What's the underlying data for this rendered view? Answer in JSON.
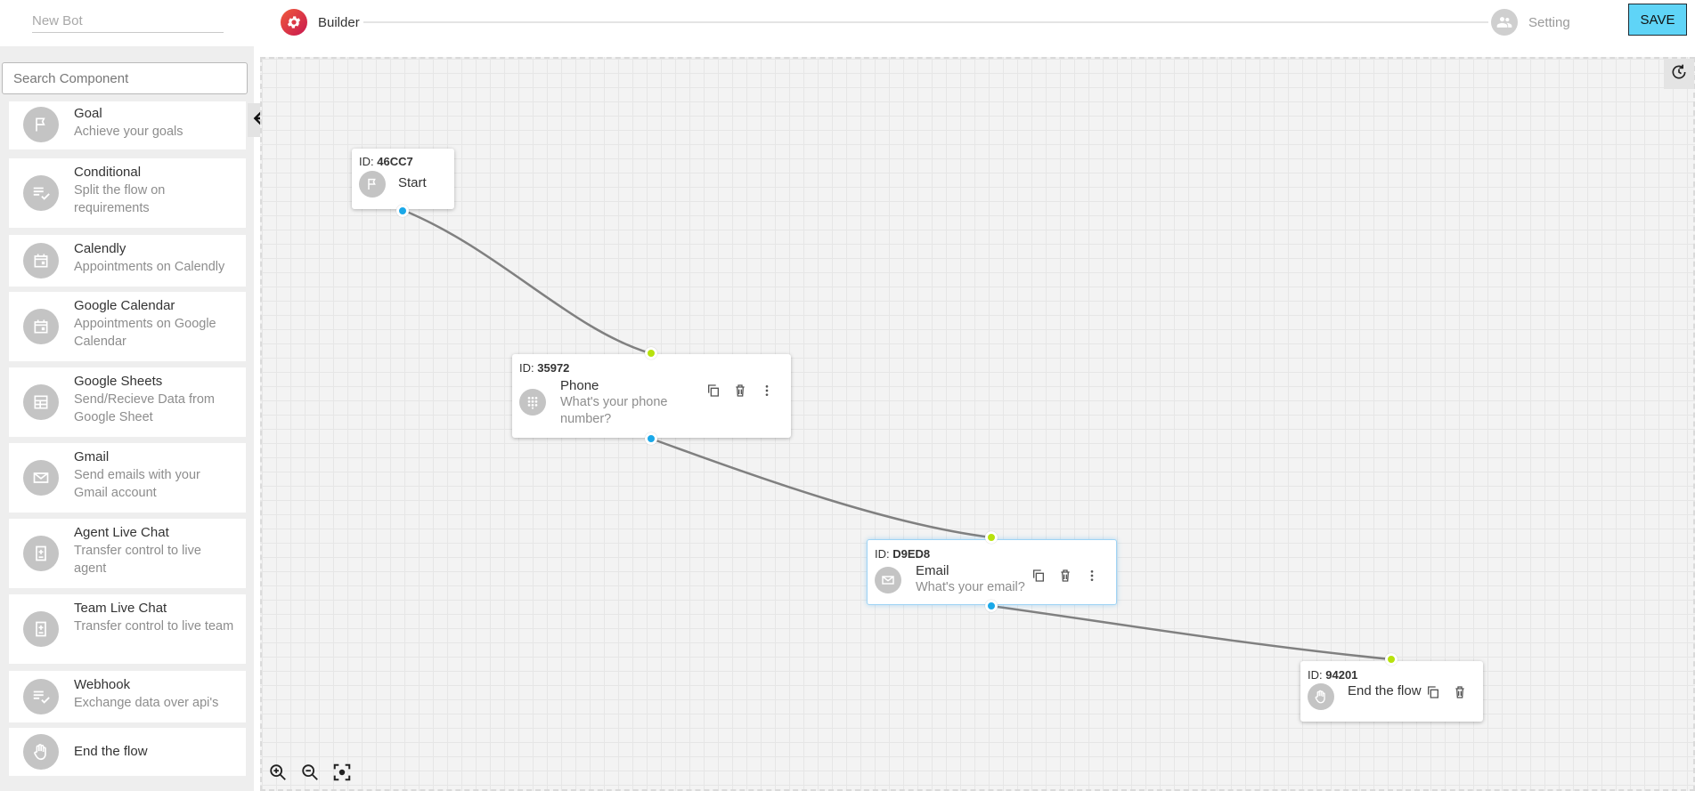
{
  "header": {
    "bot_name_placeholder": "New Bot",
    "steps": [
      {
        "label": "Builder",
        "icon": "gear-icon",
        "active": true
      },
      {
        "label": "Setting",
        "icon": "group-icon",
        "active": false
      }
    ],
    "save_label": "SAVE"
  },
  "sidebar": {
    "search_placeholder": "Search Component",
    "components": [
      {
        "title": "Goal",
        "desc": "Achieve your goals",
        "icon": "flag-icon"
      },
      {
        "title": "Conditional",
        "desc": "Split the flow on requirements",
        "icon": "checklist-icon"
      },
      {
        "title": "Calendly",
        "desc": "Appointments on Calendly",
        "icon": "calendar-icon"
      },
      {
        "title": "Google Calendar",
        "desc": "Appointments on Google Calendar",
        "icon": "calendar-icon"
      },
      {
        "title": "Google Sheets",
        "desc": "Send/Recieve Data from Google Sheet",
        "icon": "sheet-icon"
      },
      {
        "title": "Gmail",
        "desc": "Send emails with your Gmail account",
        "icon": "mail-icon"
      },
      {
        "title": "Agent Live Chat",
        "desc": "Transfer control to live agent",
        "icon": "badge-icon"
      },
      {
        "title": "Team Live Chat",
        "desc": "Transfer control to live team",
        "icon": "badge-icon"
      },
      {
        "title": "Webhook",
        "desc": "Exchange data over api's",
        "icon": "checklist-icon"
      },
      {
        "title": "End the flow",
        "desc": "",
        "icon": "hand-icon"
      }
    ]
  },
  "canvas": {
    "nodes": [
      {
        "id_label": "ID:",
        "id": "46CC7",
        "title": "Start",
        "desc": "",
        "icon": "flag-icon"
      },
      {
        "id_label": "ID:",
        "id": "35972",
        "title": "Phone",
        "desc": "What's your phone number?",
        "icon": "dialpad-icon"
      },
      {
        "id_label": "ID:",
        "id": "D9ED8",
        "title": "Email",
        "desc": "What's your email?",
        "icon": "mail-icon"
      },
      {
        "id_label": "ID:",
        "id": "94201",
        "title": "End the flow",
        "desc": "",
        "icon": "hand-icon"
      }
    ],
    "colors": {
      "edge": "#808080",
      "port_out": "#1aa8e8",
      "port_in": "#b7e20d",
      "save_button": "#5fd4f7",
      "builder_step": "#d8334a"
    }
  }
}
